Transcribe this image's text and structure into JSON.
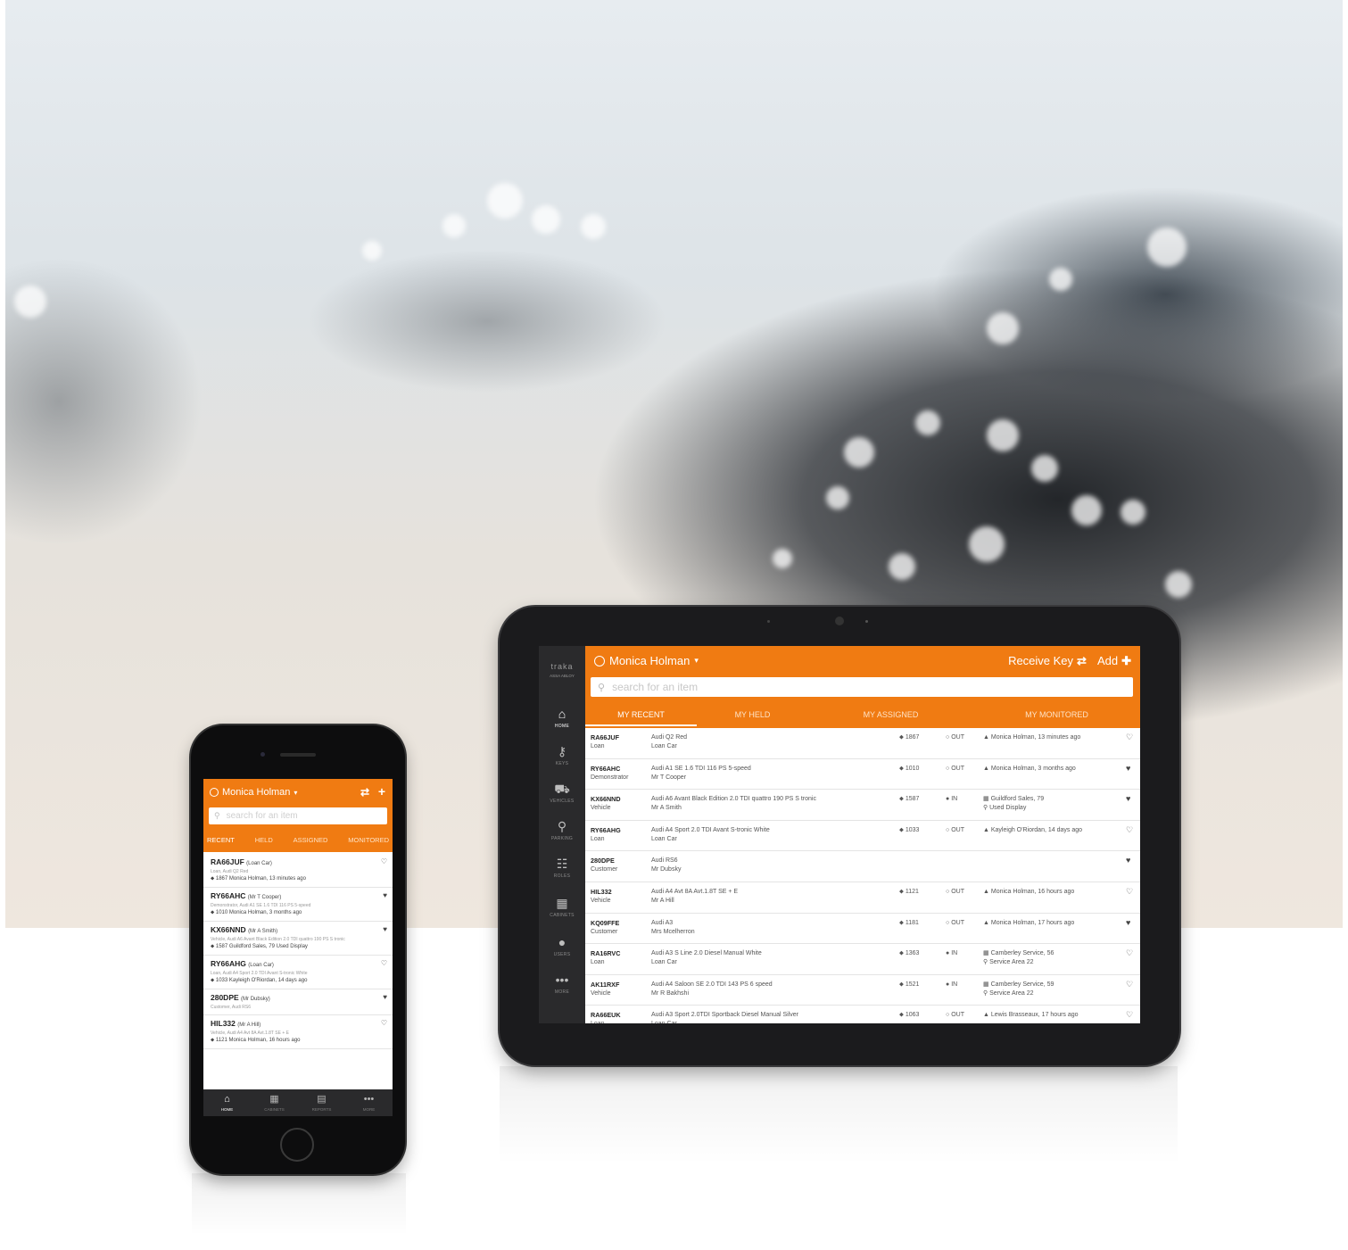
{
  "colors": {
    "accent": "#f07b12",
    "sidebar": "#2a2a2c"
  },
  "tablet": {
    "brand": "traka",
    "brand_sub": "ASSA ABLOY",
    "sidebar": [
      {
        "icon": "home-icon",
        "label": "HOME"
      },
      {
        "icon": "key-icon",
        "label": "KEYS"
      },
      {
        "icon": "car-icon",
        "label": "VEHICLES"
      },
      {
        "icon": "map-marker-icon",
        "label": "PARKING"
      },
      {
        "icon": "users-group-icon",
        "label": "ROLES"
      },
      {
        "icon": "cabinet-grid-icon",
        "label": "CABINETS"
      },
      {
        "icon": "user-icon",
        "label": "USERS"
      },
      {
        "icon": "more-icon",
        "label": "MORE"
      }
    ],
    "user": "Monica Holman",
    "receive_key": "Receive Key",
    "add": "Add",
    "search_placeholder": "search for an item",
    "tabs": [
      "MY RECENT",
      "MY HELD",
      "MY ASSIGNED",
      "MY MONITORED"
    ],
    "rows": [
      {
        "id": "RA66JUF",
        "type": "Loan",
        "desc1": "Audi Q2 Red",
        "desc2": "Loan Car",
        "key": "1867",
        "status": "OUT",
        "who1": "Monica Holman, 13 minutes ago",
        "who2": "",
        "fav": "♡"
      },
      {
        "id": "RY66AHC",
        "type": "Demonstrator",
        "desc1": "Audi A1 SE 1.6 TDI 116 PS 5-speed",
        "desc2": "Mr T Cooper",
        "key": "1010",
        "status": "OUT",
        "who1": "Monica Holman, 3 months ago",
        "who2": "",
        "fav": "♥"
      },
      {
        "id": "KX66NND",
        "type": "Vehicle",
        "desc1": "Audi A6 Avant Black Edition 2.0 TDI quattro 190 PS S tronic",
        "desc2": "Mr A Smith",
        "key": "1587",
        "status": "IN",
        "who1": "Guildford Sales, 79",
        "who2": "Used Display",
        "fav": "♥"
      },
      {
        "id": "RY66AHG",
        "type": "Loan",
        "desc1": "Audi A4 Sport 2.0 TDI Avant S-tronic White",
        "desc2": "Loan Car",
        "key": "1033",
        "status": "OUT",
        "who1": "Kayleigh O'Riordan, 14 days ago",
        "who2": "",
        "fav": "♡"
      },
      {
        "id": "280DPE",
        "type": "Customer",
        "desc1": "Audi RS6",
        "desc2": "Mr Dubsky",
        "key": "",
        "status": "",
        "who1": "",
        "who2": "",
        "fav": "♥"
      },
      {
        "id": "HIL332",
        "type": "Vehicle",
        "desc1": "Audi A4 Avt 8A Avt.1.8T SE + E",
        "desc2": "Mr A Hill",
        "key": "1121",
        "status": "OUT",
        "who1": "Monica Holman, 16 hours ago",
        "who2": "",
        "fav": "♡"
      },
      {
        "id": "KQ09FFE",
        "type": "Customer",
        "desc1": "Audi A3",
        "desc2": "Mrs Mcelherron",
        "key": "1181",
        "status": "OUT",
        "who1": "Monica Holman, 17 hours ago",
        "who2": "",
        "fav": "♥"
      },
      {
        "id": "RA16RVC",
        "type": "Loan",
        "desc1": "Audi A3 S Line 2.0 Diesel Manual White",
        "desc2": "Loan Car",
        "key": "1363",
        "status": "IN",
        "who1": "Camberley Service, 56",
        "who2": "Service Area 22",
        "fav": "♡"
      },
      {
        "id": "AK11RXF",
        "type": "Vehicle",
        "desc1": "Audi A4 Saloon SE 2.0 TDI 143 PS 6 speed",
        "desc2": "Mr R Bakhshi",
        "key": "1521",
        "status": "IN",
        "who1": "Camberley Service, 59",
        "who2": "Service Area 22",
        "fav": "♡"
      },
      {
        "id": "RA66EUK",
        "type": "Loan",
        "desc1": "Audi A3 Sport 2.0TDI Sportback Diesel Manual Silver",
        "desc2": "Loan Car",
        "key": "1063",
        "status": "OUT",
        "who1": "Lewis Brasseaux, 17 hours ago",
        "who2": "",
        "fav": "♡"
      }
    ]
  },
  "phone": {
    "user": "Monica Holman",
    "search_placeholder": "search for an item",
    "tabs": [
      "RECENT",
      "HELD",
      "ASSIGNED",
      "MONITORED"
    ],
    "rows": [
      {
        "id": "RA66JUF",
        "who": "(Loan Car)",
        "sub": "Loan, Audi Q2 Red",
        "meta": "1867  Monica Holman, 13 minutes ago",
        "fav": "♡"
      },
      {
        "id": "RY66AHC",
        "who": "(Mr T Cooper)",
        "sub": "Demonstrator, Audi A1 SE 1.6 TDI 116 PS 5-speed",
        "meta": "1010  Monica Holman, 3 months ago",
        "fav": "♥"
      },
      {
        "id": "KX66NND",
        "who": "(Mr A Smith)",
        "sub": "Vehicle, Audi A6 Avant Black Edition 2.0 TDI quattro 190 PS S tronic",
        "meta": "1587  Guildford Sales, 79  Used Display",
        "fav": "♥"
      },
      {
        "id": "RY66AHG",
        "who": "(Loan Car)",
        "sub": "Loan, Audi A4 Sport 2.0 TDI Avant S-tronic White",
        "meta": "1033  Kayleigh O'Riordan, 14 days ago",
        "fav": "♡"
      },
      {
        "id": "280DPE",
        "who": "(Mr Dubsky)",
        "sub": "Customer, Audi RS6",
        "meta": "",
        "fav": "♥"
      },
      {
        "id": "HIL332",
        "who": "(Mr A Hill)",
        "sub": "Vehicle, Audi A4 Avt 8A Avt.1.8T SE + E",
        "meta": "1121  Monica Holman, 16 hours ago",
        "fav": "♡"
      }
    ],
    "bottom_nav": [
      {
        "icon": "home-icon",
        "label": "HOME"
      },
      {
        "icon": "cabinet-grid-icon",
        "label": "CABINETS"
      },
      {
        "icon": "reports-table-icon",
        "label": "REPORTS"
      },
      {
        "icon": "more-icon",
        "label": "MORE"
      }
    ]
  }
}
